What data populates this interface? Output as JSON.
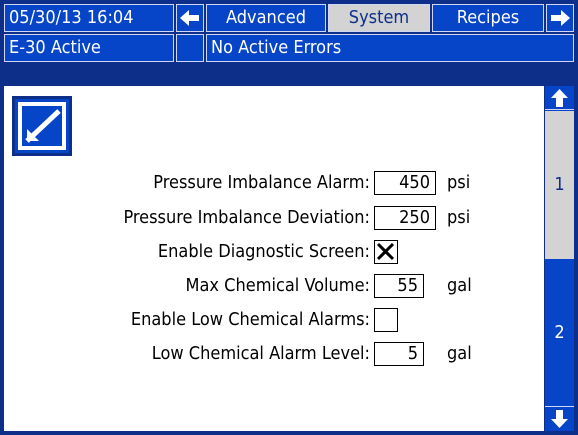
{
  "header": {
    "datetime": "05/30/13 16:04",
    "tabs": [
      {
        "label": "Advanced"
      },
      {
        "label": "System"
      },
      {
        "label": "Recipes"
      }
    ],
    "status": "E-30 Active",
    "errors": "No Active Errors"
  },
  "settings": {
    "pressure_imbalance_alarm": {
      "label": "Pressure Imbalance Alarm:",
      "value": "450",
      "unit": "psi"
    },
    "pressure_imbalance_deviation": {
      "label": "Pressure Imbalance Deviation:",
      "value": "250",
      "unit": "psi"
    },
    "enable_diagnostic_screen": {
      "label": "Enable Diagnostic Screen:",
      "checked": true
    },
    "max_chemical_volume": {
      "label": "Max Chemical Volume:",
      "value": "55",
      "unit": "gal"
    },
    "enable_low_chemical_alarms": {
      "label": "Enable Low Chemical Alarms:",
      "checked": false
    },
    "low_chemical_alarm_level": {
      "label": "Low Chemical Alarm Level:",
      "value": "5",
      "unit": "gal"
    }
  },
  "pages": [
    {
      "label": "1"
    },
    {
      "label": "2"
    }
  ],
  "colors": {
    "bar": "#0645c8",
    "frame": "#0d2f8a",
    "active_tab": "#d3d3d3",
    "panel": "#ffffff"
  }
}
